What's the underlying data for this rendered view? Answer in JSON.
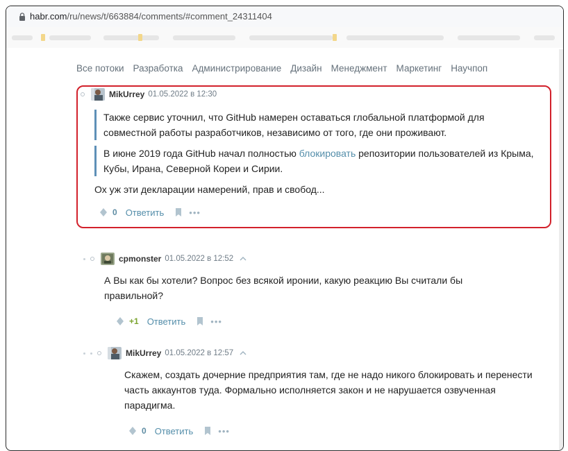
{
  "browser": {
    "url_host": "habr.com",
    "url_path": "/ru/news/t/663884/comments/#comment_24311404"
  },
  "nav": {
    "items": [
      "Все потоки",
      "Разработка",
      "Администрирование",
      "Дизайн",
      "Менеджмент",
      "Маркетинг",
      "Научпоп"
    ]
  },
  "comments": [
    {
      "author": "MikUrrey",
      "date": "01.05.2022 в 12:30",
      "quote1": "Также сервис уточнил, что GitHub намерен оставаться глобальной платформой для совместной работы разработчиков, независимо от того, где они проживают.",
      "quote2_before": "В июне 2019 года GitHub начал полностью ",
      "quote2_link": "блокировать",
      "quote2_after": " репозитории пользователей из Крыма, Кубы, Ирана, Северной Кореи и Сирии.",
      "text": "Ох уж эти декларации намерений, прав и свобод...",
      "score": "0",
      "reply_label": "Ответить"
    },
    {
      "author": "cpmonster",
      "date": "01.05.2022 в 12:52",
      "text": "А Вы как бы хотели? Вопрос без всякой иронии, какую реакцию Вы считали бы правильной?",
      "score": "+1",
      "reply_label": "Ответить"
    },
    {
      "author": "MikUrrey",
      "date": "01.05.2022 в 12:57",
      "text": "Скажем, создать дочерние предприятия там, где не надо никого блокировать и перенести часть аккаунтов туда. Формально исполняется закон и не нарушается озвученная парадигма.",
      "score": "0",
      "reply_label": "Ответить"
    }
  ],
  "icons": {
    "lock": "lock-icon",
    "vote": "vote-diamond-icon",
    "bookmark": "bookmark-icon",
    "more": "more-dots-icon",
    "caret": "chevron-up-icon"
  },
  "colors": {
    "link": "#548eaa",
    "quote_bar": "#5e90b7",
    "highlight": "#d2212b",
    "positive": "#7ba42f"
  }
}
